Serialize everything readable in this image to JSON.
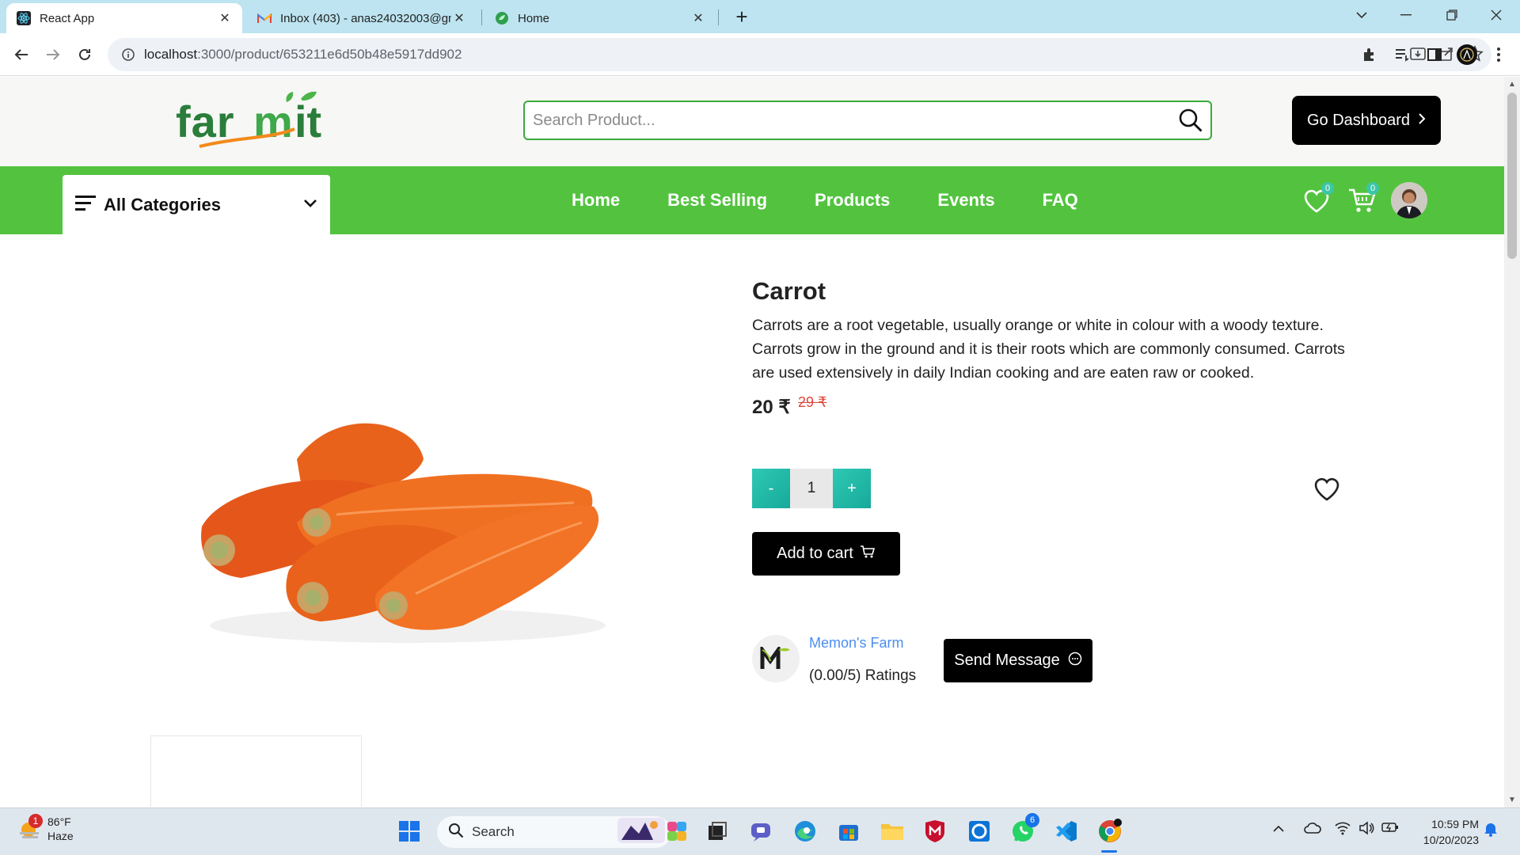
{
  "browser": {
    "tabs": [
      {
        "label": "React App",
        "active": true
      },
      {
        "label": "Inbox (403) - anas24032003@gm",
        "active": false
      },
      {
        "label": "Home",
        "active": false
      }
    ],
    "url_host": "localhost",
    "url_rest": ":3000/product/653211e6d50b48e5917dd902"
  },
  "header": {
    "logo_text": "farmit",
    "search_placeholder": "Search Product...",
    "dashboard_button": "Go Dashboard"
  },
  "nav": {
    "categories_label": "All Categories",
    "links": [
      "Home",
      "Best Selling",
      "Products",
      "Events",
      "FAQ"
    ],
    "wishlist_count": "0",
    "cart_count": "0"
  },
  "product": {
    "title": "Carrot",
    "description": "Carrots are a root vegetable, usually orange or white in colour with a woody texture. Carrots grow in the ground and it is their roots which are commonly consumed. Carrots are used extensively in daily Indian cooking and are eaten raw or cooked.",
    "price": "20 ₹",
    "original_price": "29 ₹",
    "quantity": "1",
    "decrement_label": "-",
    "increment_label": "+",
    "add_to_cart_label": "Add to cart"
  },
  "shop": {
    "name": "Memon's Farm",
    "rating": "(0.00/5) Ratings",
    "message_button": "Send Message"
  },
  "taskbar": {
    "weather_temp": "86°F",
    "weather_desc": "Haze",
    "weather_badge": "1",
    "search_label": "Search",
    "whatsapp_badge": "6",
    "time": "10:59 PM",
    "date": "10/20/2023"
  },
  "colors": {
    "brand_green": "#53c33f",
    "accent_teal": "#2ec9b4",
    "old_price_red": "#e2483d",
    "shop_link_blue": "#4b8ef0"
  }
}
